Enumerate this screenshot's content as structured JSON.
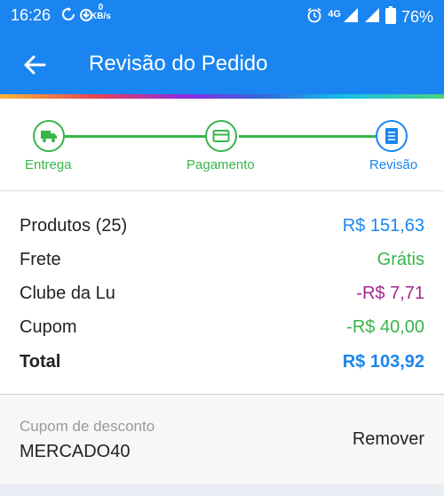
{
  "status_bar": {
    "time": "16:26",
    "speed_value": "0",
    "speed_unit": "KB/s",
    "network": "4G",
    "battery": "76%",
    "icons": [
      "sync-icon",
      "download-icon",
      "alarm-icon",
      "signal-icon",
      "signal-icon",
      "battery-icon"
    ]
  },
  "app_bar": {
    "title": "Revisão do Pedido",
    "back_icon": "arrow-left-icon",
    "color": "#1a85f0"
  },
  "steps": [
    {
      "label": "Entrega",
      "icon": "truck-icon",
      "state": "done"
    },
    {
      "label": "Pagamento",
      "icon": "credit-card-icon",
      "state": "done"
    },
    {
      "label": "Revisão",
      "icon": "list-icon",
      "state": "active"
    }
  ],
  "summary": {
    "products": {
      "label": "Produtos (25)",
      "value": "R$ 151,63",
      "color": "#1a85f0"
    },
    "shipping": {
      "label": "Frete",
      "value": "Grátis",
      "color": "#39b54a"
    },
    "club": {
      "label": "Clube da Lu",
      "value": "-R$ 7,71",
      "color": "#a4288f"
    },
    "coupon": {
      "label": "Cupom",
      "value": "-R$ 40,00",
      "color": "#39b54a"
    },
    "total": {
      "label": "Total",
      "value": "R$ 103,92",
      "color": "#1a85f0"
    }
  },
  "discount_coupon": {
    "label": "Cupom de desconto",
    "code": "MERCADO40",
    "remove_label": "Remover"
  }
}
